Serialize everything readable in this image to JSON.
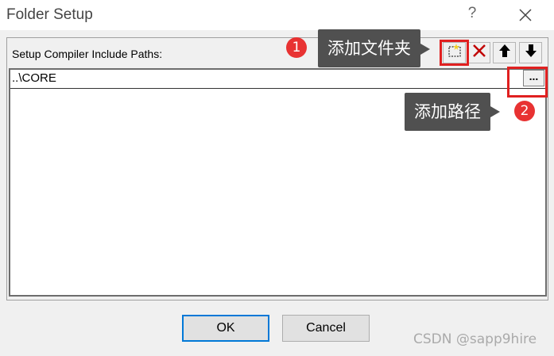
{
  "window": {
    "title": "Folder Setup",
    "help_glyph": "?"
  },
  "group": {
    "label": "Setup Compiler Include Paths:"
  },
  "toolbar": {
    "new_icon": "new-folder-icon",
    "delete_icon": "delete-x-icon",
    "move_up_icon": "arrow-up-icon",
    "move_down_icon": "arrow-down-icon"
  },
  "list": {
    "items": [
      "..\\CORE"
    ],
    "browse_label": "..."
  },
  "annotations": [
    {
      "number": "1",
      "text": "添加文件夹"
    },
    {
      "number": "2",
      "text": "添加路径"
    }
  ],
  "buttons": {
    "ok": "OK",
    "cancel": "Cancel"
  },
  "watermark": "CSDN @sapp9hire",
  "colors": {
    "highlight": "#e02020",
    "badge": "#e83232",
    "tooltip_bg": "#505050",
    "default_button_border": "#0078d7"
  }
}
